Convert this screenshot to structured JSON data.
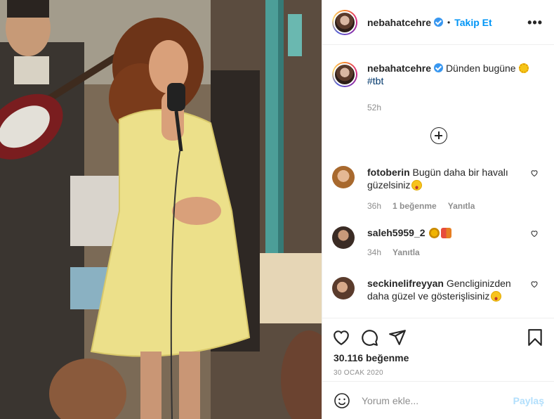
{
  "header": {
    "username": "nebahatcehre",
    "separator": "•",
    "follow_label": "Takip Et",
    "more_label": "•••"
  },
  "caption": {
    "username": "nebahatcehre",
    "text": "Dünden bugüne",
    "hashtag": "#tbt",
    "time": "52h"
  },
  "comments": [
    {
      "username": "fotoberin",
      "text": "Bugün daha bir havalı güzelsiniz",
      "time": "36h",
      "likes": "1 beğenme",
      "reply": "Yanıtla"
    },
    {
      "username": "saleh5959_2",
      "text": "",
      "time": "34h",
      "reply": "Yanıtla"
    },
    {
      "username": "seckinelifreyyan",
      "text": "Gencliginizden daha güzel ve gösterişlisiniz",
      "time": "",
      "reply": ""
    }
  ],
  "footer": {
    "likes": "30.116 beğenme",
    "date": "30 OCAK 2020",
    "comment_placeholder": "Yorum ekle...",
    "share_label": "Paylaş"
  },
  "icons": [
    "verified-badge",
    "plus-circle-icon",
    "heart-icon",
    "comment-icon",
    "share-icon",
    "bookmark-icon",
    "emoji-icon",
    "more-icon"
  ],
  "colors": {
    "accent": "#0095f6",
    "hashtag": "#00376b",
    "muted": "#8e8e8e",
    "share_disabled": "#b2dffc"
  }
}
